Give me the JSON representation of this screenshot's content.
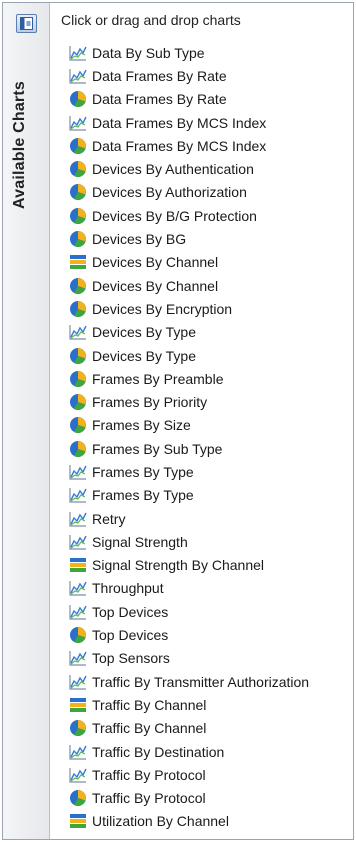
{
  "panel": {
    "title": "Available Charts",
    "hint": "Click or drag and drop charts"
  },
  "charts": [
    {
      "label": "Data By Sub Type",
      "icon": "line-chart-icon"
    },
    {
      "label": "Data Frames By Rate",
      "icon": "line-chart-icon"
    },
    {
      "label": "Data Frames By Rate",
      "icon": "pie-chart-icon"
    },
    {
      "label": "Data Frames By MCS Index",
      "icon": "line-chart-icon"
    },
    {
      "label": "Data Frames By MCS Index",
      "icon": "pie-chart-icon"
    },
    {
      "label": "Devices By Authentication",
      "icon": "pie-chart-icon"
    },
    {
      "label": "Devices By Authorization",
      "icon": "pie-chart-icon"
    },
    {
      "label": "Devices By B/G Protection",
      "icon": "pie-chart-icon"
    },
    {
      "label": "Devices By BG",
      "icon": "pie-chart-icon"
    },
    {
      "label": "Devices By Channel",
      "icon": "bar-chart-icon"
    },
    {
      "label": "Devices By Channel",
      "icon": "pie-chart-icon"
    },
    {
      "label": "Devices By Encryption",
      "icon": "pie-chart-icon"
    },
    {
      "label": "Devices By Type",
      "icon": "line-chart-icon"
    },
    {
      "label": "Devices By Type",
      "icon": "pie-chart-icon"
    },
    {
      "label": "Frames By Preamble",
      "icon": "pie-chart-icon"
    },
    {
      "label": "Frames By Priority",
      "icon": "pie-chart-icon"
    },
    {
      "label": "Frames By Size",
      "icon": "pie-chart-icon"
    },
    {
      "label": "Frames By Sub Type",
      "icon": "pie-chart-icon"
    },
    {
      "label": "Frames By Type",
      "icon": "line-chart-icon"
    },
    {
      "label": "Frames By Type",
      "icon": "line-chart-icon"
    },
    {
      "label": "Retry",
      "icon": "line-chart-icon"
    },
    {
      "label": "Signal Strength",
      "icon": "line-chart-icon"
    },
    {
      "label": "Signal Strength By Channel",
      "icon": "bar-chart-icon"
    },
    {
      "label": "Throughput",
      "icon": "line-chart-icon"
    },
    {
      "label": "Top Devices",
      "icon": "line-chart-icon"
    },
    {
      "label": "Top Devices",
      "icon": "pie-chart-icon"
    },
    {
      "label": "Top Sensors",
      "icon": "line-chart-icon"
    },
    {
      "label": "Traffic By Transmitter Authorization",
      "icon": "line-chart-icon"
    },
    {
      "label": "Traffic By Channel",
      "icon": "bar-chart-icon"
    },
    {
      "label": "Traffic By Channel",
      "icon": "pie-chart-icon"
    },
    {
      "label": "Traffic By Destination",
      "icon": "line-chart-icon"
    },
    {
      "label": "Traffic By Protocol",
      "icon": "line-chart-icon"
    },
    {
      "label": "Traffic By Protocol",
      "icon": "pie-chart-icon"
    },
    {
      "label": "Utilization By Channel",
      "icon": "bar-chart-icon"
    }
  ]
}
